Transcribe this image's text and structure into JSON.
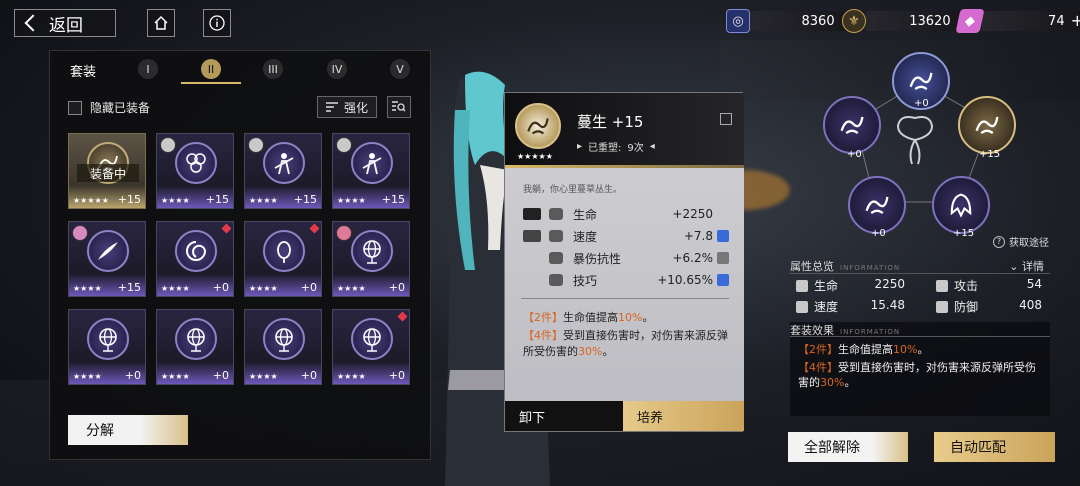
{
  "topbar": {
    "back_label": "返回",
    "currencies": [
      {
        "icon": "ticket-icon",
        "value": "8360",
        "color": "#5a6ab8"
      },
      {
        "icon": "fleur-coin-icon",
        "value": "13620",
        "color": "#c8a24a"
      },
      {
        "icon": "crystal-icon",
        "value": "74",
        "color": "#d56bd0"
      }
    ]
  },
  "inventory": {
    "title": "套装",
    "tabs": [
      "I",
      "II",
      "III",
      "IV",
      "V"
    ],
    "active_tab": "II",
    "hide_equipped_label": "隐藏已装备",
    "enhance_label": "强化",
    "equipped_tag": "装备中",
    "decompose_label": "分解",
    "cards": [
      {
        "stars": "★★★★★",
        "level": "+15",
        "equipped": true
      },
      {
        "stars": "★★★★",
        "level": "+15",
        "owner": true
      },
      {
        "stars": "★★★★",
        "level": "+15",
        "owner": true
      },
      {
        "stars": "★★★★",
        "level": "+15",
        "owner": true
      },
      {
        "stars": "★★★★",
        "level": "+15",
        "owner": true
      },
      {
        "stars": "★★★★",
        "level": "+0",
        "flag": true
      },
      {
        "stars": "★★★★",
        "level": "+0",
        "flag": true
      },
      {
        "stars": "★★★★",
        "level": "+0",
        "owner": true
      },
      {
        "stars": "★★★★",
        "level": "+0"
      },
      {
        "stars": "★★★★",
        "level": "+0"
      },
      {
        "stars": "★★★★",
        "level": "+0"
      },
      {
        "stars": "★★★★",
        "level": "+0",
        "flag": true
      }
    ]
  },
  "detail": {
    "name": "蔓生",
    "level": "+15",
    "stars": "★★★★★",
    "reforge_label": "已重塑:",
    "reforge_count": "9次",
    "quote": "我躺，你心里蔓草丛生。",
    "stats": [
      {
        "name": "生命",
        "value": "+2250",
        "buff": false
      },
      {
        "name": "速度",
        "value": "+7.8",
        "buff": true
      },
      {
        "name": "暴伤抗性",
        "value": "+6.2%",
        "buff": true
      },
      {
        "name": "技巧",
        "value": "+10.65%",
        "buff": true
      }
    ],
    "set2_tag": "【2件】",
    "set2_text": "生命值提高",
    "set2_value": "10%",
    "set2_end": "。",
    "set4_tag": "【4件】",
    "set4_text": "受到直接伤害时，对伤害来源反弹所受伤害的",
    "set4_value": "30%",
    "set4_end": "。",
    "unequip_label": "卸下",
    "cultivate_label": "培养"
  },
  "set_graph": {
    "levels": [
      "+0",
      "+0",
      "+15",
      "+0",
      "+15"
    ],
    "get_way_label": "获取途径"
  },
  "attributes": {
    "title": "属性总览",
    "title_en": "INFORMATION",
    "details_label": "详情",
    "items": [
      {
        "name": "生命",
        "value": "2250"
      },
      {
        "name": "攻击",
        "value": "54"
      },
      {
        "name": "速度",
        "value": "15.48"
      },
      {
        "name": "防御",
        "value": "408"
      }
    ]
  },
  "set_effects": {
    "title": "套装效果",
    "title_en": "INFORMATION",
    "line2_tag": "【2件】",
    "line2_text": "生命值提高",
    "line2_value": "10%",
    "line2_end": "。",
    "line4_tag": "【4件】",
    "line4_text": "受到直接伤害时，对伤害来源反弹所受伤害的",
    "line4_value": "30%",
    "line4_end": "。"
  },
  "buttons": {
    "unequip_all": "全部解除",
    "auto_match": "自动匹配"
  },
  "colors": {
    "accent_gold": "#d8b86a",
    "accent_purple": "#7e72bf",
    "highlight_orange": "#d9651f"
  }
}
